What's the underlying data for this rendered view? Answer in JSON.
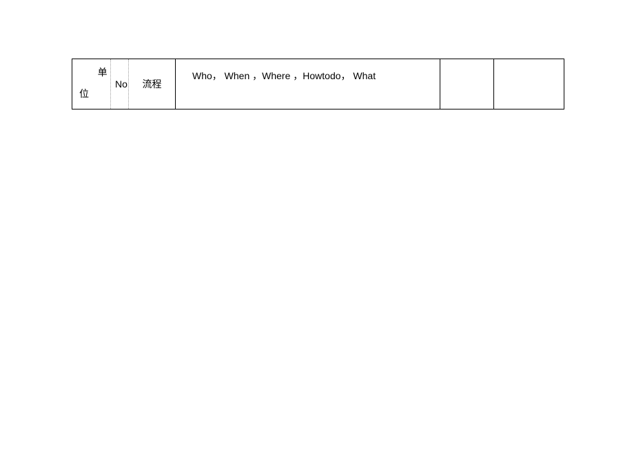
{
  "table": {
    "header": {
      "unit_line1": "单",
      "unit_line2": "位",
      "no": "No",
      "flow": "流程",
      "detail": "Who，  When ，Where ，Howtodo，  What",
      "blank1": "",
      "blank2": ""
    }
  }
}
